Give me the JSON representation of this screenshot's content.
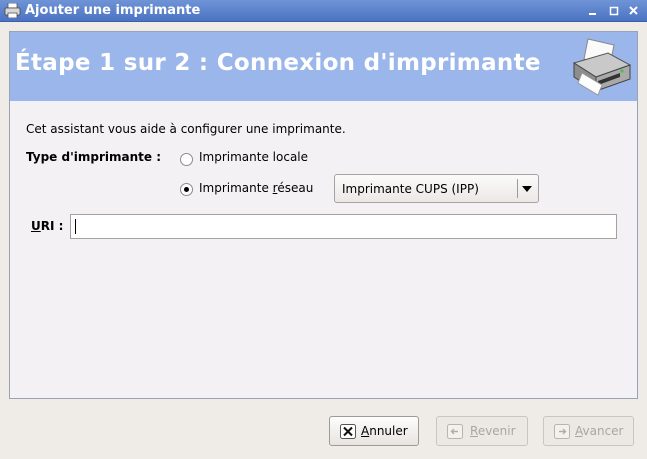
{
  "window": {
    "title": "Ajouter une imprimante",
    "app_icon": "printer-icon",
    "controls": [
      "minimize-icon",
      "maximize-icon",
      "close-icon"
    ]
  },
  "header": {
    "step_title": "Étape 1 sur 2 : Connexion d'imprimante",
    "icon": "printer-icon",
    "background": "#9bb6ea"
  },
  "form": {
    "intro": "Cet assistant vous aide à configurer une imprimante.",
    "printer_type_label": "Type d'imprimante :",
    "options": {
      "local": {
        "label": "Imprimante locale",
        "selected": false
      },
      "network": {
        "label_prefix": "Imprimante ",
        "label_mnemonic": "r",
        "label_rest": "éseau",
        "selected": true
      }
    },
    "network_type": {
      "selected": "Imprimante CUPS (IPP)"
    },
    "uri": {
      "label_mnemonic": "U",
      "label_rest": "RI :",
      "value": ""
    }
  },
  "buttons": {
    "cancel": {
      "mnemonic": "A",
      "rest": "nnuler",
      "icon": "cancel-x-icon",
      "enabled": true
    },
    "back": {
      "mnemonic": "R",
      "rest": "evenir",
      "icon": "back-arrow-icon",
      "enabled": false
    },
    "next": {
      "mnemonic": "A",
      "rest": "vancer",
      "icon": "forward-arrow-icon",
      "enabled": false
    }
  }
}
